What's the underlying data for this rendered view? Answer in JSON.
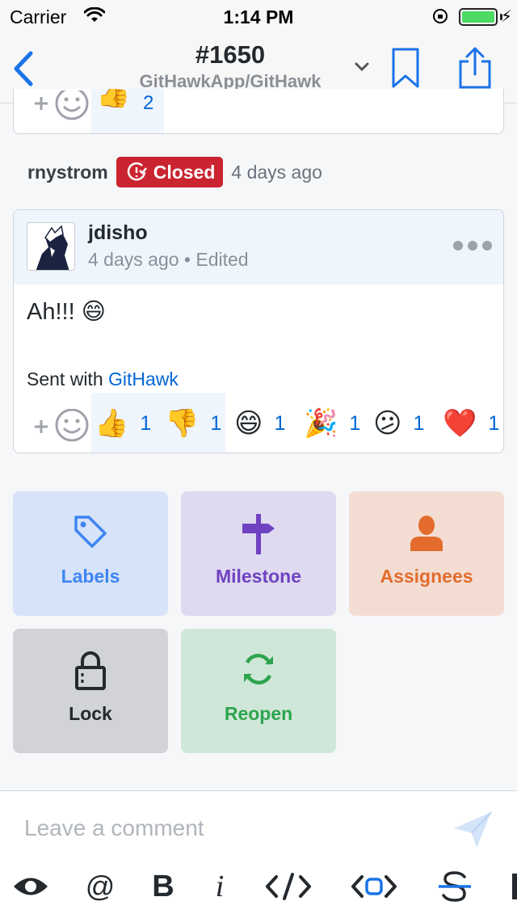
{
  "status_bar": {
    "carrier": "Carrier",
    "time": "1:14 PM",
    "battery_level": 1.0
  },
  "nav": {
    "title": "#1650",
    "subtitle": "GitHawkApp/GitHawk",
    "icons": [
      "back-chevron-icon",
      "chevron-down-icon",
      "bookmark-icon",
      "share-icon"
    ]
  },
  "previous_comment": {
    "reaction_emoji": "👍",
    "reaction_count": "2"
  },
  "event": {
    "user": "rnystrom",
    "badge_label": "Closed",
    "time_ago": "4 days ago",
    "badge_color": "#cb2431"
  },
  "comment": {
    "author": "jdisho",
    "meta": "4 days ago • Edited",
    "body": "Ah!!! 😄",
    "footer_prefix": "Sent with ",
    "footer_link": "GitHawk",
    "reactions": [
      {
        "emoji": "👍",
        "count": "1"
      },
      {
        "emoji": "👎",
        "count": "1"
      },
      {
        "emoji": "😄",
        "count": "1"
      },
      {
        "emoji": "🎉",
        "count": "1"
      },
      {
        "emoji": "😕",
        "count": "1"
      },
      {
        "emoji": "❤️",
        "count": "1"
      }
    ]
  },
  "actions": {
    "labels": "Labels",
    "milestone": "Milestone",
    "assignees": "Assignees",
    "lock": "Lock",
    "reopen": "Reopen",
    "colors": {
      "labels": "#3e85f2",
      "milestone": "#6f42c1",
      "assignees": "#e36c2c",
      "lock": "#24292e",
      "reopen": "#2ea44f"
    }
  },
  "composer": {
    "placeholder": "Leave a comment",
    "toolbar": [
      "eye-icon",
      "mention-icon",
      "bold-icon",
      "italic-icon",
      "code-icon",
      "code-block-icon",
      "strikethrough-icon"
    ],
    "toolbar_labels": {
      "mention": "@",
      "bold": "B",
      "italic": "i"
    }
  }
}
